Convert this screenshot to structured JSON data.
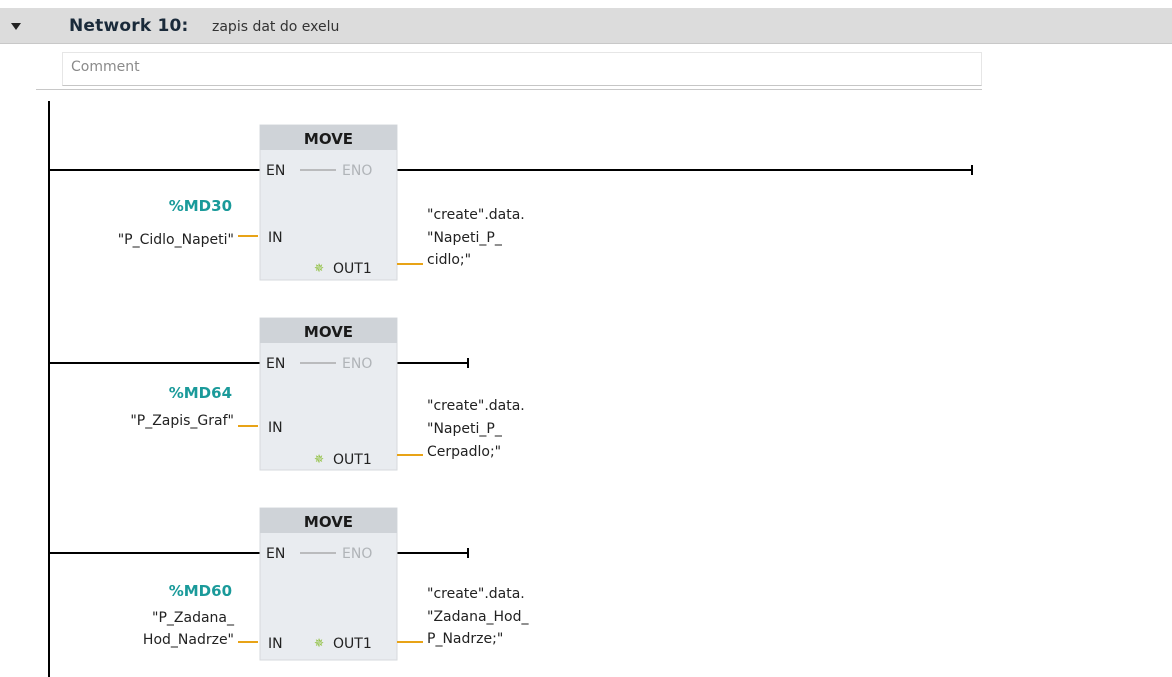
{
  "network": {
    "title": "Network 10:",
    "description": "zapis dat do exelu",
    "comment_placeholder": "Comment"
  },
  "blocks": [
    {
      "name": "MOVE",
      "en_label": "EN",
      "eno_label": "ENO",
      "in_label": "IN",
      "out_label": "OUT1",
      "in_address": "%MD30",
      "in_tag_lines": [
        "\"P_Cidlo_Napeti\""
      ],
      "out_tag_lines": [
        "\"create\".data.",
        "\"Napeti_P_",
        "cidlo;\""
      ]
    },
    {
      "name": "MOVE",
      "en_label": "EN",
      "eno_label": "ENO",
      "in_label": "IN",
      "out_label": "OUT1",
      "in_address": "%MD64",
      "in_tag_lines": [
        "\"P_Zapis_Graf\""
      ],
      "out_tag_lines": [
        "\"create\".data.",
        "\"Napeti_P_",
        "Cerpadlo;\""
      ]
    },
    {
      "name": "MOVE",
      "en_label": "EN",
      "eno_label": "ENO",
      "in_label": "IN",
      "out_label": "OUT1",
      "in_address": "%MD60",
      "in_tag_lines": [
        "\"P_Zadana_",
        "Hod_Nadrze\""
      ],
      "out_tag_lines": [
        "\"create\".data.",
        "\"Zadana_Hod_",
        "P_Nadrze;\""
      ]
    }
  ],
  "colors": {
    "wire": "#000000",
    "parameter_wire": "#e8a317",
    "address": "#1a9a9a",
    "block_fill": "#e9ecf0",
    "block_header": "#cfd3d8",
    "eno_text": "#b0b4b8",
    "en_text": "#222222",
    "wire_gray": "#8a8a8a",
    "star_icon": "#8dbf3a"
  },
  "icons": {
    "collapse": "triangle-down-icon",
    "out_marker": "green-star-icon"
  }
}
